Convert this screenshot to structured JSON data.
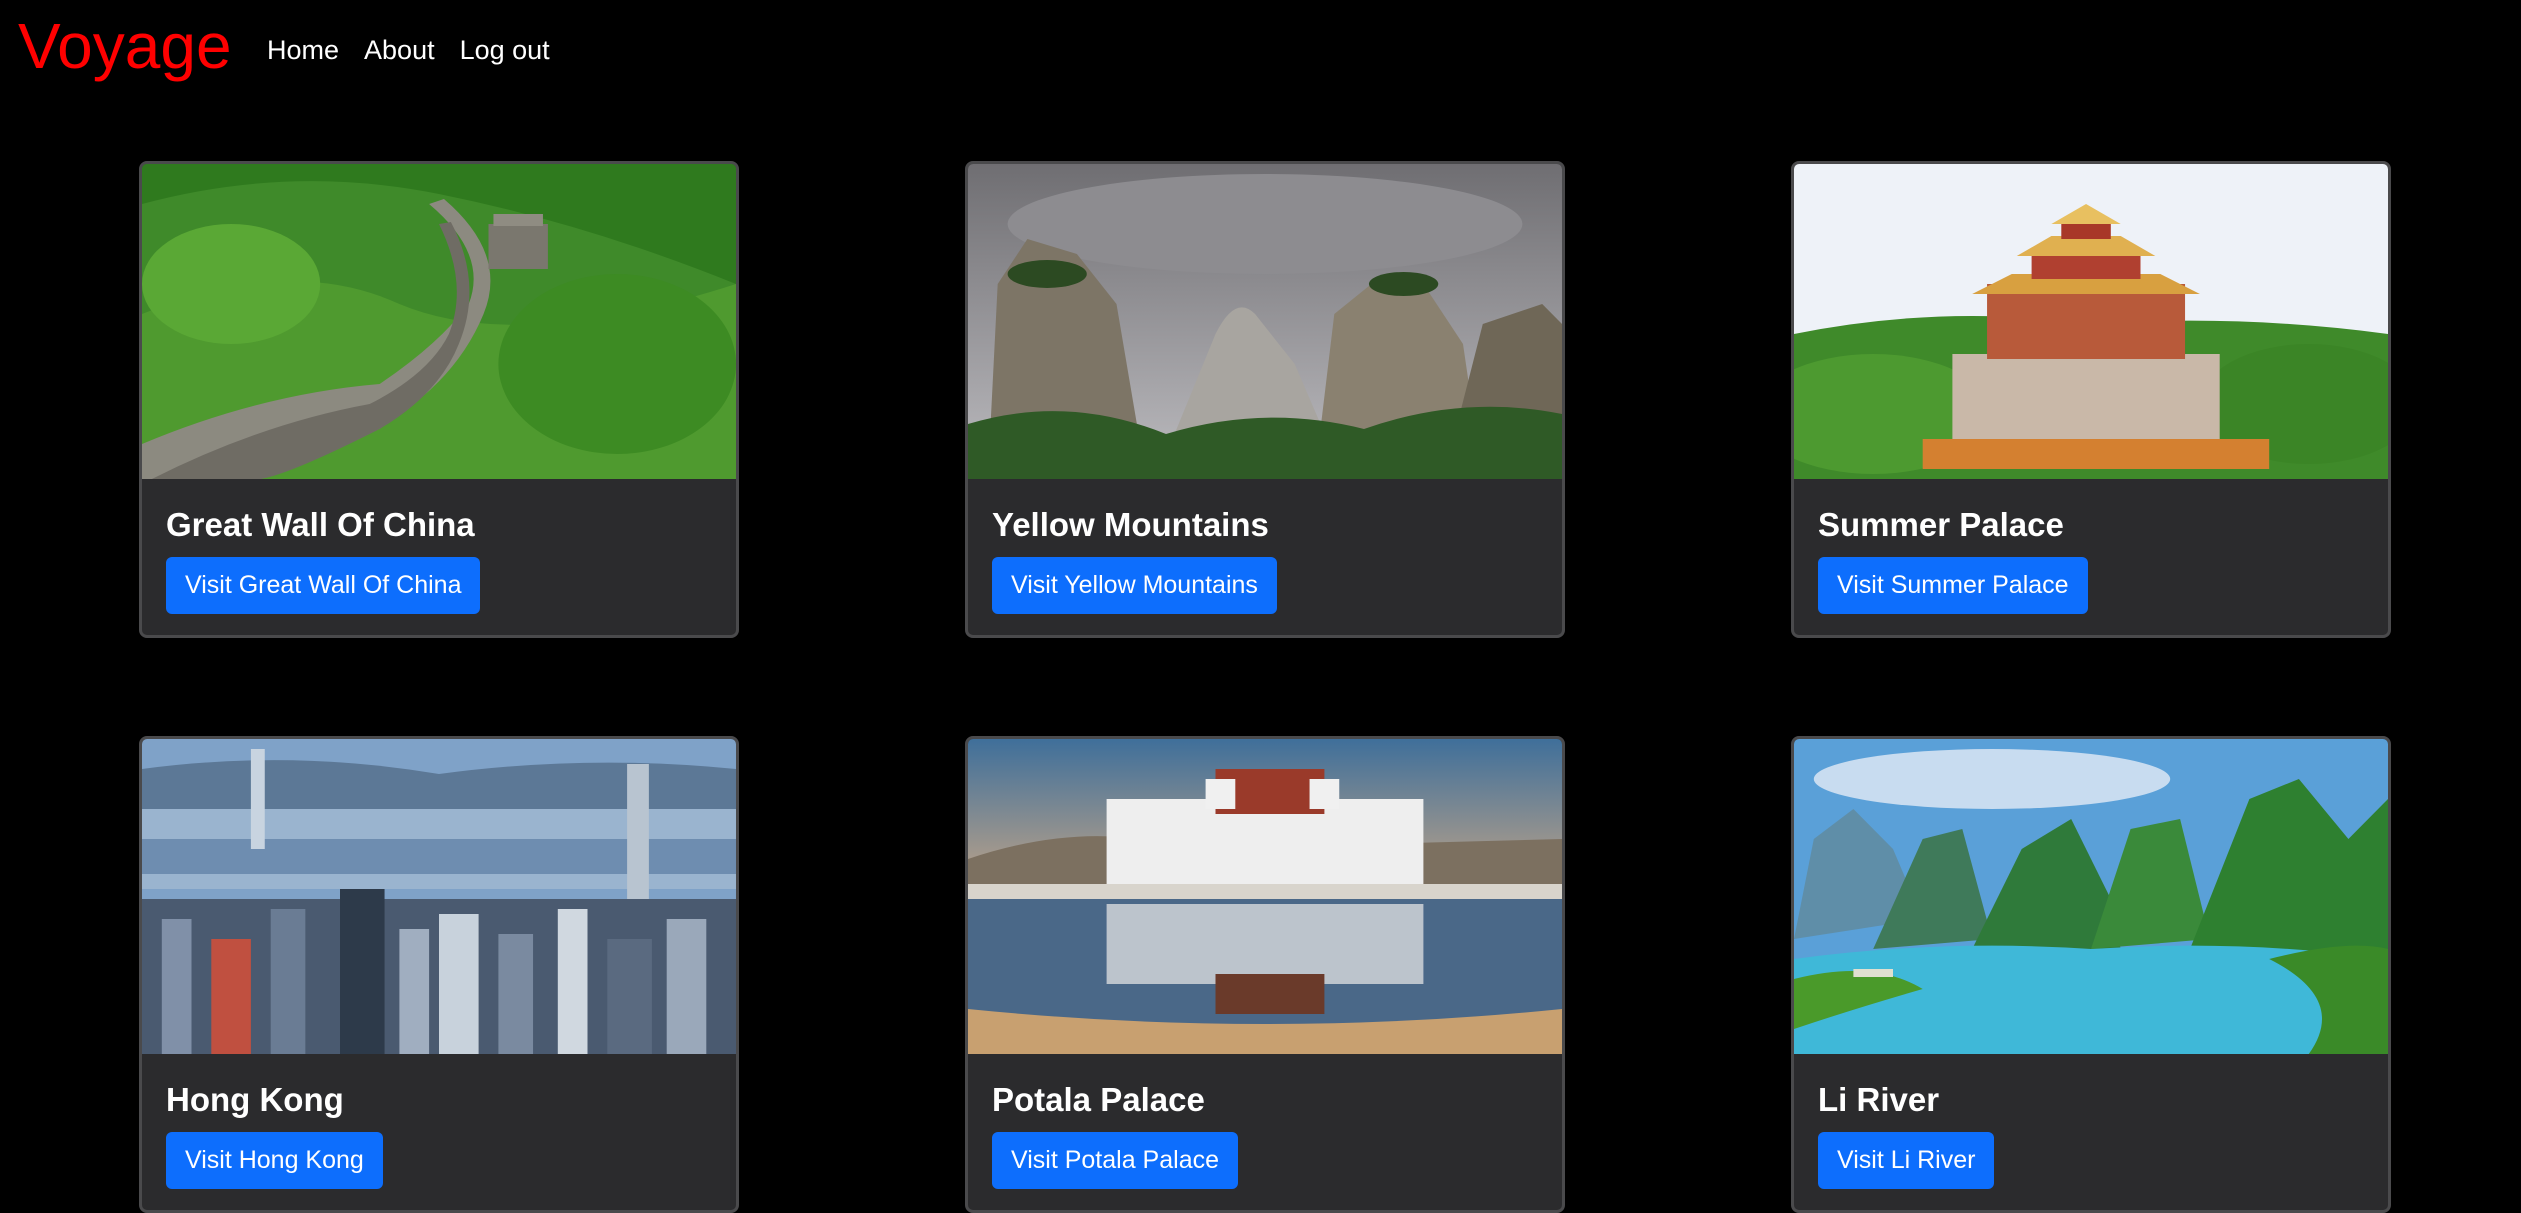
{
  "navbar": {
    "brand": "Voyage",
    "links": [
      "Home",
      "About",
      "Log out"
    ]
  },
  "colors": {
    "brand": "#ff0000",
    "button": "#0d6efd",
    "card_bg": "#2b2b2d",
    "page_bg": "#000000"
  },
  "destinations": [
    {
      "title": "Great Wall Of China",
      "button": "Visit Great Wall Of China",
      "image": "great-wall-photo"
    },
    {
      "title": "Yellow Mountains",
      "button": "Visit Yellow Mountains",
      "image": "yellow-mountains-photo"
    },
    {
      "title": "Summer Palace",
      "button": "Visit Summer Palace",
      "image": "summer-palace-photo"
    },
    {
      "title": "Hong Kong",
      "button": "Visit Hong Kong",
      "image": "hong-kong-photo"
    },
    {
      "title": "Potala Palace",
      "button": "Visit Potala Palace",
      "image": "potala-palace-photo"
    },
    {
      "title": "Li River",
      "button": "Visit Li River",
      "image": "li-river-photo"
    }
  ]
}
